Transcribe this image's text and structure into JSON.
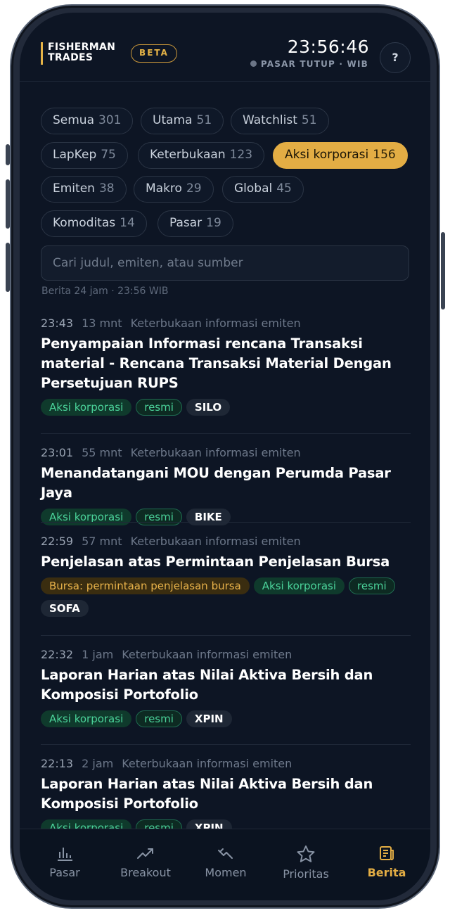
{
  "header": {
    "logo_line1": "FISHERMAN",
    "logo_line2": "TRADES",
    "badge": "BETA",
    "clock": "23:56:46",
    "market_status": "PASAR TUTUP · WIB",
    "help_label": "?"
  },
  "filters": [
    {
      "label": "Semua",
      "count": "301"
    },
    {
      "label": "Utama",
      "count": "51"
    },
    {
      "label": "Watchlist",
      "count": "51"
    },
    {
      "label": "LapKep",
      "count": "75"
    },
    {
      "label": "Keterbukaan",
      "count": "123"
    },
    {
      "label": "Aksi korporasi",
      "count": "156"
    },
    {
      "label": "Emiten",
      "count": "38"
    },
    {
      "label": "Makro",
      "count": "29"
    },
    {
      "label": "Global",
      "count": "45"
    },
    {
      "label": "Komoditas",
      "count": "14"
    },
    {
      "label": "Pasar",
      "count": "19"
    }
  ],
  "active_filter": "Aksi korporasi",
  "search": {
    "placeholder": "Cari judul, emiten, atau sumber",
    "value": ""
  },
  "feed_meta": "Berita 24 jam · 23:56 WIB",
  "news": [
    {
      "time": "23:43",
      "ago": "13 mnt",
      "source": "Keterbukaan informasi emiten",
      "title": "Penyampaian Informasi rencana Transaksi material - Rencana Transaksi Material Dengan Persetujuan RUPS",
      "tags": [
        "Aksi korporasi",
        "resmi",
        "SILO"
      ]
    },
    {
      "time": "23:01",
      "ago": "55 mnt",
      "source": "Keterbukaan informasi emiten",
      "title": "Menandatangani MOU dengan Perumda Pasar Jaya",
      "tags": [
        "Aksi korporasi",
        "resmi",
        "BIKE"
      ]
    },
    {
      "time": "22:59",
      "ago": "57 mnt",
      "source": "Keterbukaan informasi emiten",
      "title": "Penjelasan atas Permintaan Penjelasan Bursa",
      "tags": [
        "Bursa: permintaan penjelasan bursa",
        "Aksi korporasi",
        "resmi",
        "SOFA"
      ]
    },
    {
      "time": "22:32",
      "ago": "1 jam",
      "source": "Keterbukaan informasi emiten",
      "title": "Laporan Harian atas Nilai Aktiva Bersih dan Komposisi Portofolio",
      "tags": [
        "Aksi korporasi",
        "resmi",
        "XPIN"
      ]
    },
    {
      "time": "22:13",
      "ago": "2 jam",
      "source": "Keterbukaan informasi emiten",
      "title": "Laporan Harian atas Nilai Aktiva Bersih dan Komposisi Portofolio",
      "tags": [
        "Aksi korporasi",
        "resmi",
        "XPIN"
      ]
    }
  ],
  "nav": [
    {
      "label": "Pasar",
      "icon": "bar-chart-icon"
    },
    {
      "label": "Breakout",
      "icon": "trend-up-icon"
    },
    {
      "label": "Momen",
      "icon": "momentum-icon"
    },
    {
      "label": "Prioritas",
      "icon": "star-icon"
    },
    {
      "label": "Berita",
      "icon": "newspaper-icon"
    }
  ],
  "active_nav": "Berita",
  "colors": {
    "accent": "#e3ad44",
    "background": "#0d1524",
    "tag_green": "#4bd39a",
    "tag_amber": "#e8b24a"
  }
}
